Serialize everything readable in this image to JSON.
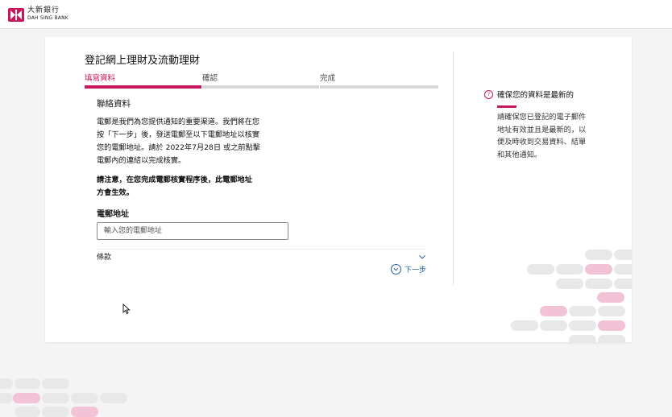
{
  "header": {
    "logo_cn": "大新銀行",
    "logo_en": "DAH SING BANK"
  },
  "page": {
    "title": "登記網上理財及流動理財"
  },
  "steps": [
    {
      "label": "填寫資料",
      "active": true
    },
    {
      "label": "確認",
      "active": false
    },
    {
      "label": "完成",
      "active": false
    }
  ],
  "form": {
    "section_title": "聯絡資料",
    "paragraph_lines": [
      "電郵是我們為您提供通知的重要渠道。我們將在您",
      "按「下一步」後，發送電郵至以下電郵地址以核實",
      "您的電郵地址。請於 2022年7月28日 或之前點擊",
      "電郵內的連結以完成核實。"
    ],
    "notice_lines": [
      "請注意，在您完成電郵核實程序後，此電郵地址",
      "方會生效。"
    ],
    "email_label": "電郵地址",
    "email_placeholder": "輸入您的電郵地址",
    "email_value": "",
    "terms_label": "條款",
    "next_label": "下一步"
  },
  "side_panel": {
    "title": "確保您的資料是最新的",
    "text_lines": [
      "請確保您已登記的電子郵件",
      "地址有效並且是最新的，以",
      "便及時收到交易資料、結單",
      "和其他通知。"
    ]
  },
  "colors": {
    "accent": "#c8175d",
    "link": "#1f5f99",
    "progress_inactive": "#d8d8d8",
    "page_bg": "#f4f4f4"
  }
}
